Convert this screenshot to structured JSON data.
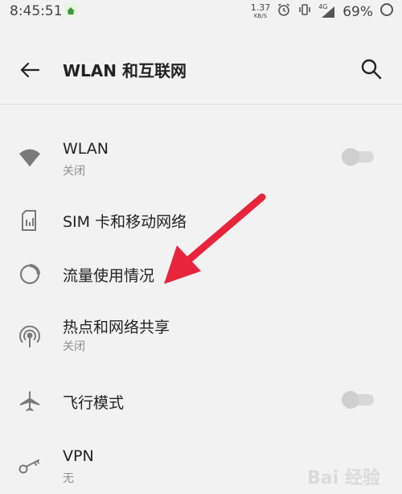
{
  "status_bar": {
    "time": "8:45:51",
    "net_speed_value": "1.37",
    "net_speed_unit": "KB/S",
    "network_type": "4G",
    "battery_percent": "69%"
  },
  "toolbar": {
    "title": "WLAN 和互联网"
  },
  "items": [
    {
      "label": "WLAN",
      "sub": "关闭",
      "icon": "wifi-icon",
      "toggle": false
    },
    {
      "label": "SIM 卡和移动网络",
      "sub": "",
      "icon": "sim-card-icon"
    },
    {
      "label": "流量使用情况",
      "sub": "",
      "icon": "data-usage-icon"
    },
    {
      "label": "热点和网络共享",
      "sub": "关闭",
      "icon": "hotspot-icon"
    },
    {
      "label": "飞行模式",
      "sub": "",
      "icon": "airplane-icon",
      "toggle": false
    },
    {
      "label": "VPN",
      "sub": "无",
      "icon": "key-icon"
    }
  ],
  "watermark": {
    "text": "Bai 经验"
  },
  "colors": {
    "background": "#f2f2f2",
    "arrow": "#e8243c",
    "icon": "#7a7a7a",
    "subtext": "#8e8e8e"
  }
}
